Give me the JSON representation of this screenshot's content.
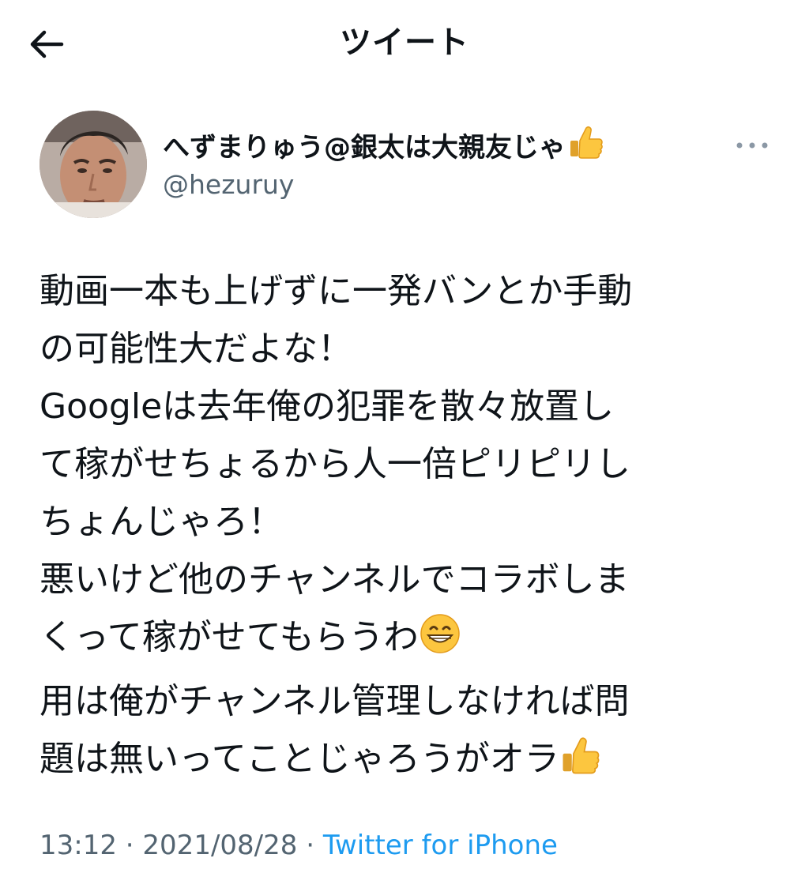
{
  "header": {
    "title": "ツイート",
    "back_icon": "arrow-left-icon"
  },
  "tweet": {
    "author": {
      "display_name": "へずまりゅう@銀太は大親友じゃ",
      "name_emoji": "thumbs-up-icon",
      "handle": "@hezuruy"
    },
    "more_icon": "ellipsis-icon",
    "body_lines": [
      "動画一本も上げずに一発バンとか手動",
      "の可能性大だよな！",
      "Googleは去年俺の犯罪を散々放置し",
      "て稼がせちょるから人一倍ピリピリし",
      "ちょんじゃろ！",
      "悪いけど他のチャンネルでコラボしま",
      "くって稼がせてもらうわ",
      "用は俺がチャンネル管理しなければ問",
      "題は無いってことじゃろうがオラ"
    ],
    "body_emojis": {
      "line7": "grinning-face-icon",
      "line9": "thumbs-up-icon"
    },
    "time": "13:12",
    "separator": "·",
    "date": "2021/08/28",
    "source": "Twitter for iPhone"
  },
  "colors": {
    "text": "#0f1419",
    "secondary": "#536471",
    "link": "#1d9bf0"
  }
}
